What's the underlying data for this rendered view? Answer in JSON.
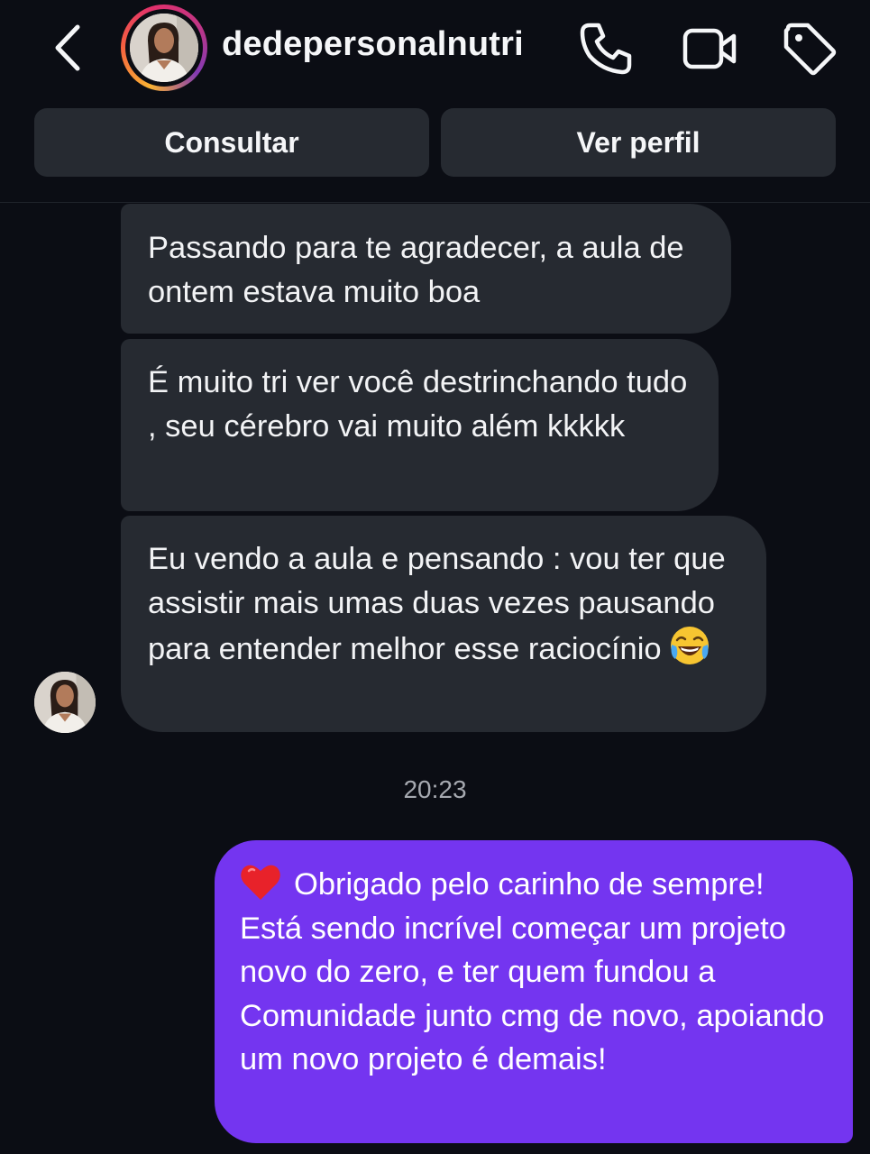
{
  "header": {
    "username": "dedepersonalnutri",
    "icons": [
      "back-arrow-icon",
      "phone-icon",
      "video-camera-icon",
      "tag-icon"
    ]
  },
  "actions": {
    "consult_label": "Consultar",
    "profile_label": "Ver perfil"
  },
  "received": [
    {
      "text": "Passando para te agradecer, a aula de ontem estava muito boa"
    },
    {
      "text": "É muito tri ver você destrinchando tudo , seu cérebro vai muito além kkkkk"
    },
    {
      "text": "Eu vendo a aula e pensando : vou ter que assistir mais umas duas vezes pausando para entender melhor esse raciocínio",
      "emoji": "face-with-tears-of-joy"
    }
  ],
  "timestamp": "20:23",
  "sent": {
    "emoji": "red-heart",
    "text": "Obrigado pelo carinho de sempre! Está sendo incrível começar um projeto novo do zero, e ter quem fundou a Comunidade junto cmg de novo, apoiando um novo projeto é demais!"
  },
  "colors": {
    "background": "#0b0d14",
    "received_bubble": "#262a31",
    "sent_bubble": "#7435f0",
    "button": "#262a31"
  }
}
